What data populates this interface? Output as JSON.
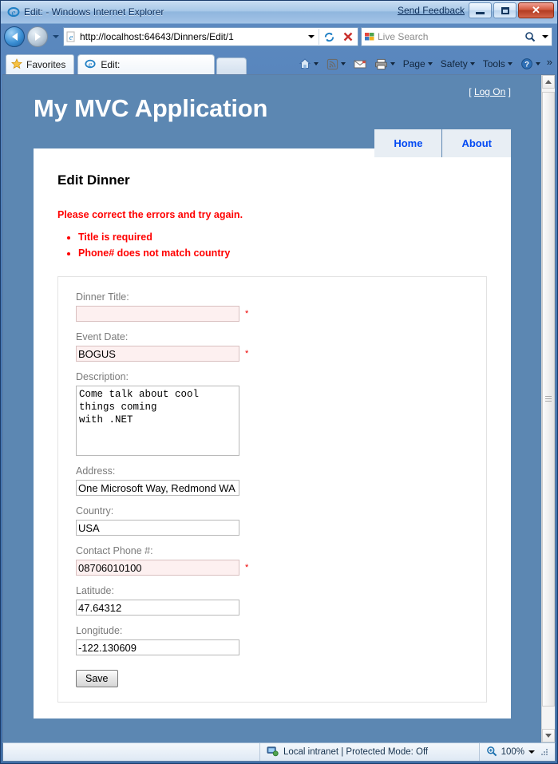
{
  "browser": {
    "title": "Edit: - Windows Internet Explorer",
    "send_feedback": "Send Feedback",
    "minimize_label": "Minimize",
    "maximize_label": "Maximize",
    "close_label": "Close",
    "url": "http://localhost:64643/Dinners/Edit/1",
    "search_placeholder": "Live Search",
    "favorites_label": "Favorites",
    "tab_label": "Edit:",
    "commands": [
      {
        "label": "Page"
      },
      {
        "label": "Safety"
      },
      {
        "label": "Tools"
      }
    ],
    "overflow_label": "»"
  },
  "statusbar": {
    "zone": "Local intranet | Protected Mode: Off",
    "zoom": "100%"
  },
  "site": {
    "title": "My MVC Application",
    "logon_prefix": "[",
    "logon_label": "Log On",
    "logon_suffix": "]",
    "menu": [
      {
        "label": "Home"
      },
      {
        "label": "About"
      }
    ]
  },
  "page": {
    "heading": "Edit Dinner",
    "validation_summary": "Please correct the errors and try again.",
    "validation_errors": [
      "Title is required",
      "Phone# does not match country"
    ],
    "required_marker": "*",
    "fields": [
      {
        "label": "Dinner Title:",
        "value": "",
        "error": true,
        "required_marker": true,
        "type": "text"
      },
      {
        "label": "Event Date:",
        "value": "BOGUS",
        "error": true,
        "required_marker": true,
        "type": "text"
      },
      {
        "label": "Description:",
        "value": "Come talk about cool\nthings coming\nwith .NET",
        "error": false,
        "required_marker": false,
        "type": "textarea"
      },
      {
        "label": "Address:",
        "value": "One Microsoft Way, Redmond WA",
        "error": false,
        "required_marker": false,
        "type": "text"
      },
      {
        "label": "Country:",
        "value": "USA",
        "error": false,
        "required_marker": false,
        "type": "text"
      },
      {
        "label": "Contact Phone #:",
        "value": "08706010100",
        "error": true,
        "required_marker": true,
        "type": "text"
      },
      {
        "label": "Latitude:",
        "value": "47.64312",
        "error": false,
        "required_marker": false,
        "type": "text"
      },
      {
        "label": "Longitude:",
        "value": "-122.130609",
        "error": false,
        "required_marker": false,
        "type": "text"
      }
    ],
    "save_label": "Save"
  },
  "colors": {
    "site_header_blue": "#5C87B2",
    "menu_tab_bg": "#E8EEF4",
    "menu_link": "#034af3",
    "error_red": "#FF0000",
    "error_field_bg": "#FDF0F0",
    "label_gray": "#7A7A7A"
  }
}
